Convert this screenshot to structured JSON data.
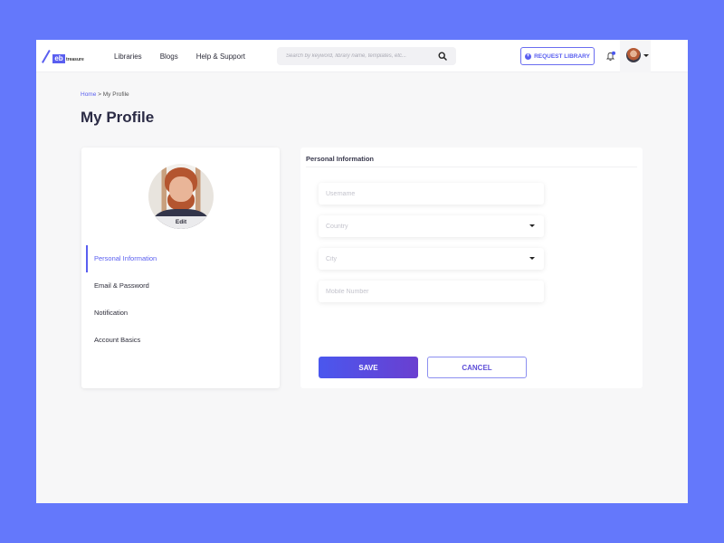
{
  "brand": {
    "logo_mark": "eb",
    "logo_word": "treasure",
    "accent_color": "#5a5ff0"
  },
  "nav": {
    "items": [
      {
        "label": "Libraries"
      },
      {
        "label": "Blogs"
      },
      {
        "label": "Help & Support"
      }
    ]
  },
  "search": {
    "placeholder": "Search by keyword, library name, templates, etc...",
    "value": "",
    "icon": "search-icon"
  },
  "header": {
    "request_library_label": "REQUEST LIBRARY",
    "notification_icon": "bell-icon",
    "user_menu_icon": "chevron-down-icon"
  },
  "breadcrumb": {
    "home": "Home",
    "separator": " > ",
    "current": "My Profile"
  },
  "page": {
    "title": "My Profile"
  },
  "profile_card": {
    "edit_label": "Edit",
    "menu": [
      {
        "label": "Personal Information",
        "active": true
      },
      {
        "label": "Email & Password",
        "active": false
      },
      {
        "label": "Notification",
        "active": false
      },
      {
        "label": "Account Basics",
        "active": false
      }
    ]
  },
  "form": {
    "section_title": "Personal Information",
    "fields": {
      "username": {
        "placeholder": "Username",
        "value": ""
      },
      "country": {
        "placeholder": "Country",
        "value": ""
      },
      "city": {
        "placeholder": "City",
        "value": ""
      },
      "mobile": {
        "placeholder": "Mobile Number",
        "value": ""
      }
    },
    "save_label": "SAVE",
    "cancel_label": "CANCEL"
  }
}
